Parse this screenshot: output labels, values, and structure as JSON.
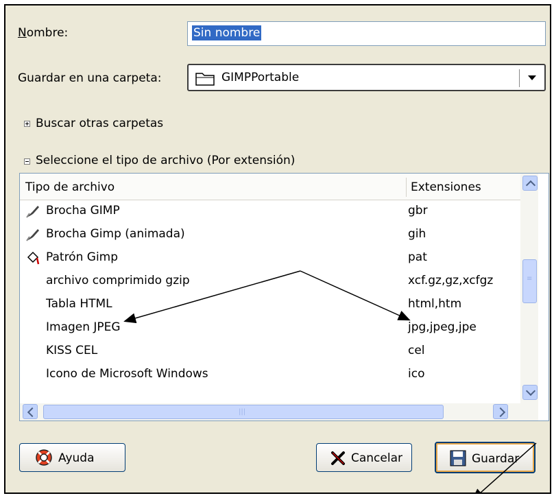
{
  "dialog": {
    "name_label": "Nombre:",
    "name_value": "Sin nombre",
    "folder_label": "Guardar en una carpeta:",
    "folder_value": "GIMPPortable",
    "browse_label": "Buscar otras carpetas",
    "filetype_label": "Seleccione el tipo de archivo  (Por extensión)"
  },
  "table": {
    "headers": [
      "Tipo de archivo",
      "Extensiones"
    ],
    "rows": [
      {
        "type": "Brocha GIMP",
        "ext": "gbr",
        "icon": "brush-icon"
      },
      {
        "type": "Brocha Gimp (animada)",
        "ext": "gih",
        "icon": "brush-icon"
      },
      {
        "type": "Patrón Gimp",
        "ext": "pat",
        "icon": "paint-bucket-icon"
      },
      {
        "type": "archivo comprimido gzip",
        "ext": "xcf.gz,gz,xcfgz",
        "icon": ""
      },
      {
        "type": "Tabla HTML",
        "ext": "html,htm",
        "icon": ""
      },
      {
        "type": "Imagen JPEG",
        "ext": "jpg,jpeg,jpe",
        "icon": ""
      },
      {
        "type": "KISS CEL",
        "ext": "cel",
        "icon": ""
      },
      {
        "type": "Icono de Microsoft Windows",
        "ext": "ico",
        "icon": ""
      }
    ]
  },
  "buttons": {
    "help": "Ayuda",
    "cancel": "Cancelar",
    "save": "Guardar"
  },
  "colors": {
    "dialog_bg": "#ece9d8",
    "selection": "#316ac5",
    "scroll_blue": "#c1d3fb"
  }
}
